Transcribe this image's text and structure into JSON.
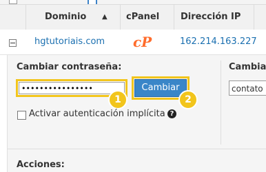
{
  "table": {
    "headers": [
      "Dominio",
      "cPanel",
      "Dirección IP"
    ],
    "sort_arrow": "▲",
    "row": {
      "domain": "hgtutoriais.com",
      "cpanel_logo_text": "cP",
      "ip": "162.214.163.227"
    }
  },
  "form": {
    "change_password_label": "Cambiar contraseña:",
    "password_value": "••••••••••••••••",
    "change_button_label": "Cambiar",
    "checkbox_label": "Activar autenticación implícita",
    "help_icon_glyph": "?",
    "right_section_label": "Cambia",
    "right_input_value": "contato",
    "actions_label": "Acciones:"
  },
  "annotations": {
    "step1": "1",
    "step2": "2",
    "highlight_color": "#f2c51c"
  },
  "colors": {
    "link": "#1a6fb0",
    "button": "#3a86c8",
    "cpanel": "#ff6c2c"
  }
}
